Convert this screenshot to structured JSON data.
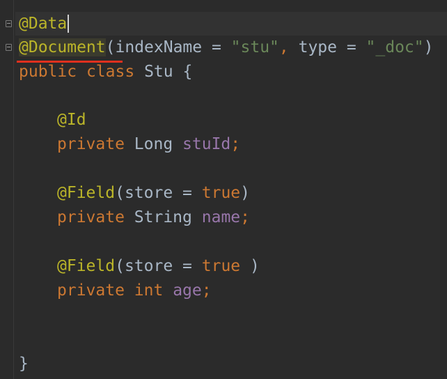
{
  "editor": {
    "lines": {
      "l1": {
        "annotation": "@Data"
      },
      "l2": {
        "annotation": "@Document",
        "open_paren": "(",
        "param1_name": "indexName",
        "eq1": " = ",
        "param1_value": "\"stu\"",
        "comma": ", ",
        "param2_name": "type",
        "eq2": " = ",
        "param2_value": "\"_doc\"",
        "close_paren": ")"
      },
      "l3": {
        "kw_public": "public",
        "kw_class": "class",
        "class_name": "Stu",
        "brace": "{"
      },
      "l5": {
        "annotation": "@Id"
      },
      "l6": {
        "kw": "private",
        "type": "Long",
        "name": "stuId",
        "semi": ";"
      },
      "l8": {
        "annotation": "@Field",
        "open_paren": "(",
        "param_name": "store",
        "eq": " = ",
        "param_value": "true",
        "close_paren": ")"
      },
      "l9": {
        "kw": "private",
        "type": "String",
        "name": "name",
        "semi": ";"
      },
      "l11": {
        "annotation": "@Field",
        "open_paren": "(",
        "param_name": "store",
        "eq": " = ",
        "param_value": "true",
        "close_paren": " )"
      },
      "l12": {
        "kw": "private",
        "type": "int",
        "name": "age",
        "semi": ";"
      },
      "l15": {
        "brace": "}"
      }
    },
    "colors": {
      "background": "#2b2b2b",
      "annotation": "#bbb529",
      "keyword": "#cc7832",
      "string": "#6a8759",
      "field": "#9876aa",
      "text": "#a9b7c6",
      "underline": "#e0301e"
    }
  }
}
